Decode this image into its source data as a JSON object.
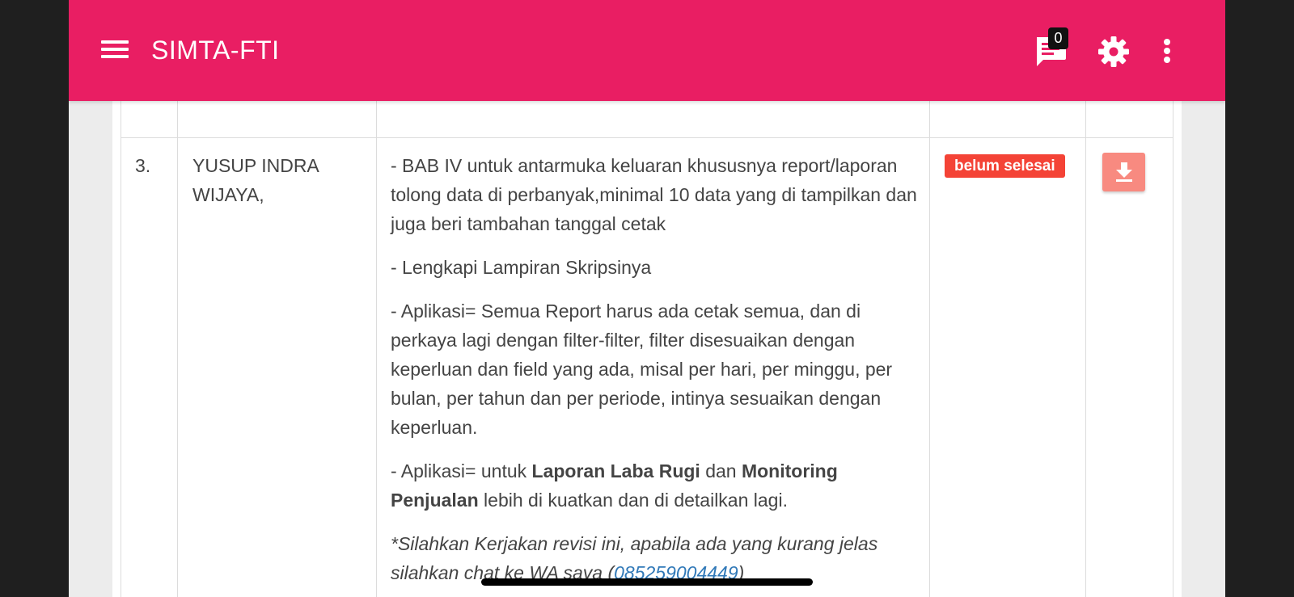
{
  "header": {
    "title": "SIMTA-FTI",
    "message_count": "0",
    "icons": [
      "menu-icon",
      "message-icon",
      "gear-icon",
      "more-vert-icon"
    ]
  },
  "table": {
    "row": {
      "number": "3.",
      "name": "YUSUP INDRA WIJAYA,",
      "notes": {
        "p1": "- BAB IV untuk antarmuka keluaran khususnya report/laporan tolong data di perbanyak,minimal 10 data yang di tampilkan dan juga beri tambahan tanggal cetak",
        "p2": "- Lengkapi Lampiran Skripsinya",
        "p3": "- Aplikasi= Semua Report harus ada cetak semua, dan di perkaya lagi dengan filter-filter, filter disesuaikan dengan keperluan dan field yang ada, misal per hari, per minggu, per bulan, per tahun dan per periode, intinya sesuaikan dengan keperluan.",
        "p4_prefix": "- Aplikasi= untuk ",
        "p4_bold1": "Laporan Laba Rugi",
        "p4_mid": " dan ",
        "p4_bold2": "Monitoring Penjualan",
        "p4_suffix": " lebih di kuatkan dan di detailkan lagi.",
        "p5_prefix": "*Silahkan Kerjakan revisi ini, apabila ada yang kurang jelas silahkan chat ke WA saya (",
        "p5_link": "085259004449",
        "p5_suffix": ")"
      },
      "status": "belum selesai",
      "action_icon": "download-icon"
    }
  },
  "colors": {
    "primary": "#e91e63",
    "status_danger": "#f44336",
    "download_button": "#f88a80",
    "link": "#3179b8"
  }
}
